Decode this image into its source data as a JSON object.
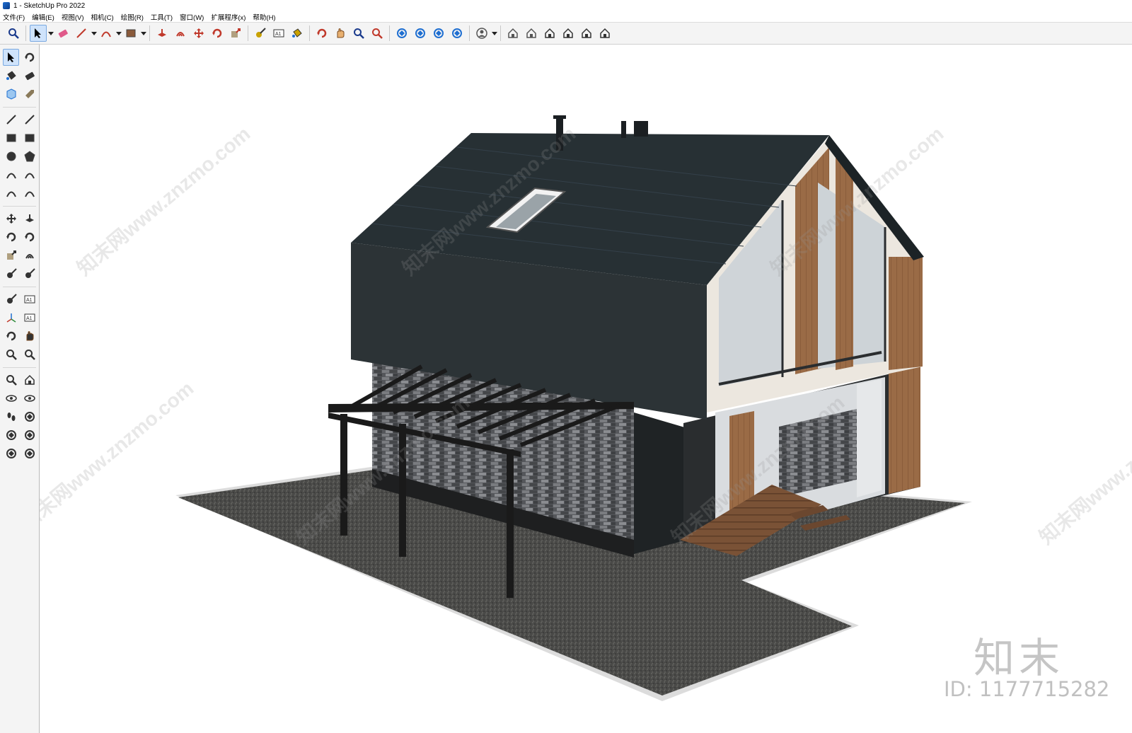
{
  "window": {
    "title": "1 - SketchUp Pro 2022"
  },
  "menu": [
    "文件(F)",
    "编辑(E)",
    "视图(V)",
    "相机(C)",
    "绘图(R)",
    "工具(T)",
    "窗口(W)",
    "扩展程序(x)",
    "帮助(H)"
  ],
  "toolbar": {
    "tools": [
      {
        "name": "zoom-icon",
        "color": "#1a3a8c"
      },
      {
        "name": "select-icon",
        "color": "#000000",
        "active": true
      },
      {
        "name": "eraser-icon",
        "color": "#e05a8a"
      },
      {
        "name": "line-icon",
        "color": "#c0392b"
      },
      {
        "name": "arc-icon",
        "color": "#c0392b"
      },
      {
        "name": "rectangle-icon",
        "color": "#8a5a3a"
      },
      {
        "name": "push-pull-icon",
        "color": "#c0392b"
      },
      {
        "name": "offset-icon",
        "color": "#c0392b"
      },
      {
        "name": "move-icon",
        "color": "#c0392b"
      },
      {
        "name": "rotate-icon",
        "color": "#c0392b"
      },
      {
        "name": "scale-icon",
        "color": "#c0392b"
      },
      {
        "name": "tape-measure-icon",
        "color": "#c9a200"
      },
      {
        "name": "text-icon",
        "color": "#333333"
      },
      {
        "name": "paint-bucket-icon",
        "color": "#c9a200"
      },
      {
        "name": "orbit-icon",
        "color": "#c0392b"
      },
      {
        "name": "pan-icon",
        "color": "#e8b070"
      },
      {
        "name": "zoom-tool-icon",
        "color": "#1a3a8c"
      },
      {
        "name": "zoom-extents-icon",
        "color": "#c0392b"
      },
      {
        "name": "warehouse-icon",
        "color": "#1f6fd1"
      },
      {
        "name": "extension-warehouse-icon",
        "color": "#1f6fd1"
      },
      {
        "name": "layout-icon",
        "color": "#1f6fd1"
      },
      {
        "name": "extension-manager-icon",
        "color": "#1f6fd1"
      },
      {
        "name": "user-icon",
        "color": "#555555"
      },
      {
        "name": "iso-view-icon",
        "color": "#555555"
      },
      {
        "name": "top-view-icon",
        "color": "#555555"
      },
      {
        "name": "front-view-icon",
        "color": "#333333"
      },
      {
        "name": "right-view-icon",
        "color": "#333333"
      },
      {
        "name": "back-view-icon",
        "color": "#333333"
      },
      {
        "name": "left-view-icon",
        "color": "#333333"
      }
    ]
  },
  "sidebar": {
    "tools": [
      "select-icon",
      "orbit-icon",
      "paint-bucket-icon",
      "eraser-icon",
      "component-icon",
      "tag-icon",
      "line-icon",
      "freehand-icon",
      "rectangle-icon",
      "rotated-rectangle-icon",
      "circle-icon",
      "polygon-icon",
      "arc-icon",
      "two-point-arc-icon",
      "three-point-arc-icon",
      "pie-icon",
      "move-icon",
      "push-pull-icon",
      "rotate-icon",
      "follow-me-icon",
      "scale-icon",
      "offset-icon",
      "tape-measure-icon",
      "dimension-icon",
      "protractor-icon",
      "text-icon",
      "axes-icon",
      "3d-text-icon",
      "orbit-tool-icon",
      "pan-icon",
      "zoom-icon",
      "zoom-window-icon",
      "zoom-extents-icon",
      "previous-view-icon",
      "position-camera-icon",
      "look-around-icon",
      "walk-icon",
      "section-plane-icon",
      "warehouse-icon",
      "extension-warehouse-icon",
      "layout-icon",
      "extension-manager-icon"
    ]
  },
  "watermarks": {
    "site": "知末网www.znzmo.com",
    "logo": "知末",
    "id": "ID: 1177715282"
  }
}
